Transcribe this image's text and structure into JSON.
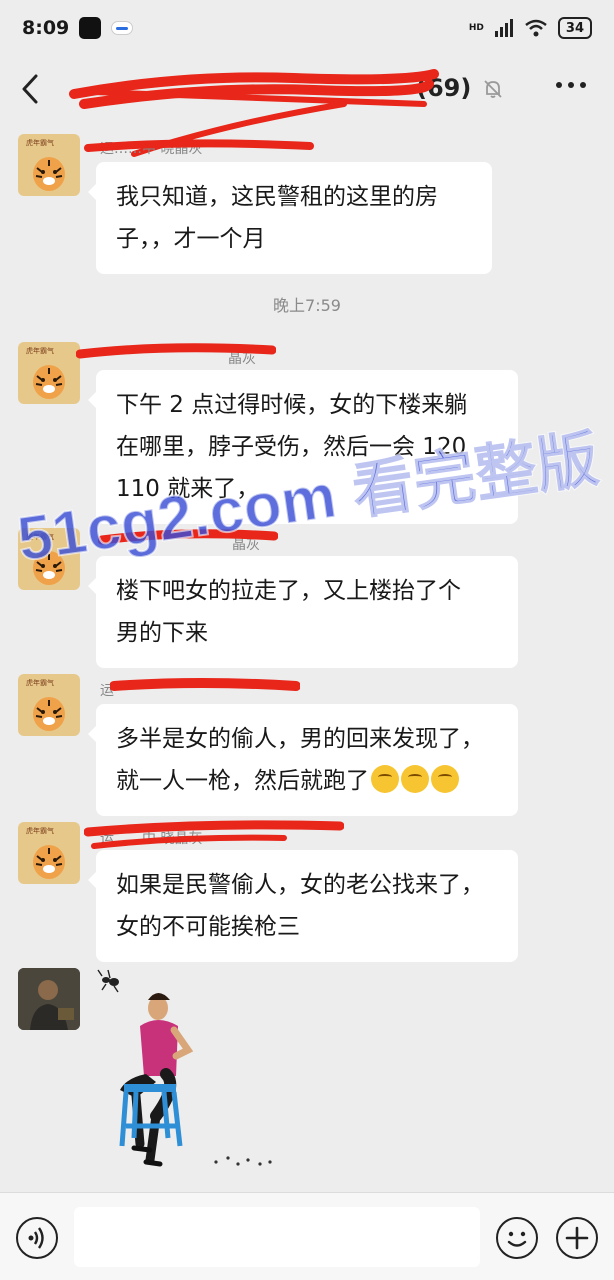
{
  "status_bar": {
    "time": "8:09",
    "network": "HD",
    "battery": "34"
  },
  "header": {
    "back_icon": "chevron-left-icon",
    "title_suffix": "(69)",
    "mute_icon": "bell-off-icon",
    "more_icon": "more-horizontal-icon"
  },
  "messages": [
    {
      "sender": "运……中 晓晶灰",
      "lines": [
        "我只知道，这民警租的这里的房",
        "子，，才一个月"
      ]
    },
    {
      "sender": "晶灰",
      "lines": [
        "下午 2 点过得时候，女的下楼来躺",
        "在哪里，脖子受伤，然后一会 120",
        "110 就来了，"
      ]
    },
    {
      "sender": "晶灰",
      "lines": [
        "楼下吧女的拉走了，又上楼抬了个",
        "男的下来"
      ]
    },
    {
      "sender": "运",
      "lines": [
        "多半是女的偷人，男的回来发现了，",
        "就一人一枪，然后就跑了"
      ]
    },
    {
      "sender": "运……中 晓晶灰",
      "lines": [
        "如果是民警偷人，女的老公找来了，",
        "女的不可能挨枪三"
      ]
    }
  ],
  "timestamp": "晚上7:59",
  "watermark": {
    "line1": "51cg2.com 看完整版"
  },
  "avatar_badge": "虎年霸气",
  "input_bar": {
    "voice_icon": "voice-icon",
    "emoji_icon": "smiley-icon",
    "plus_icon": "plus-circle-icon"
  },
  "colors": {
    "background": "#ededed",
    "bubble": "#ffffff",
    "watermark": "#3a4fd6",
    "redaction": "#e8261a"
  }
}
